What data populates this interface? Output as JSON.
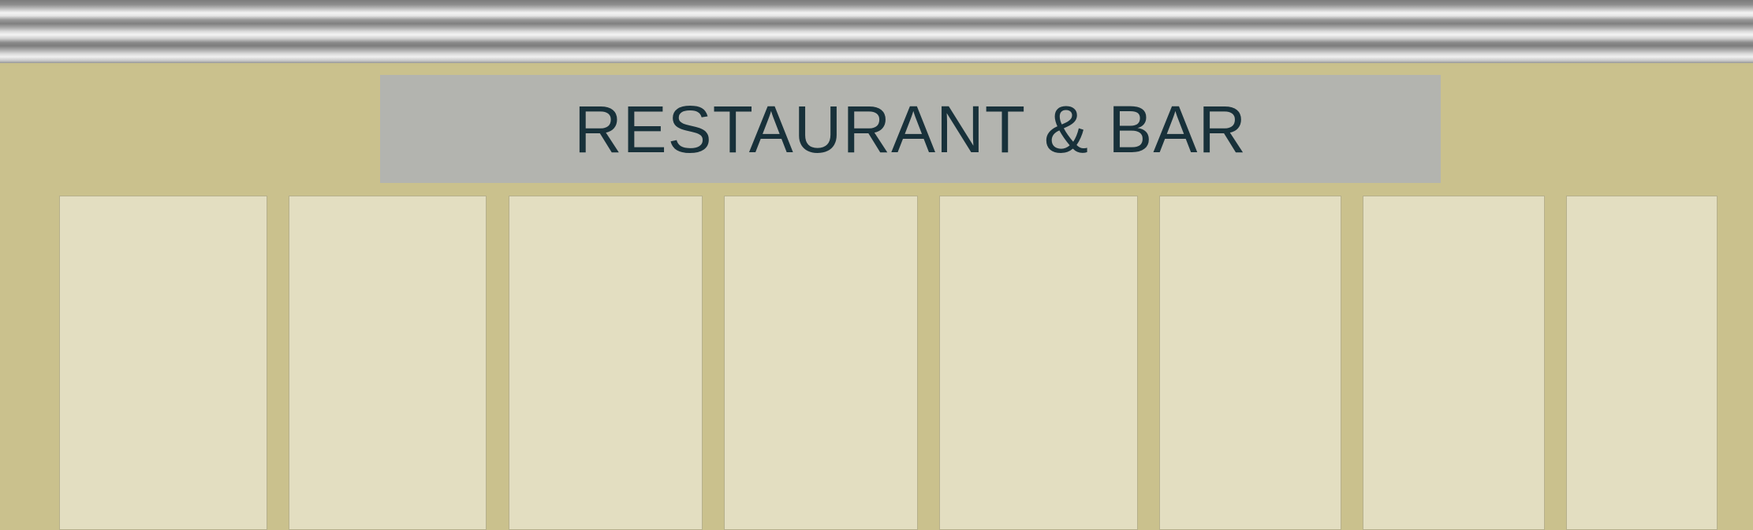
{
  "sign": {
    "text": "RESTAURANT & BAR"
  },
  "colors": {
    "facade": "#cac18d",
    "signboard": "#b3b4af",
    "sign_text": "#18313a",
    "window": "#e3dec1",
    "awning_dark": "#7b7b7b",
    "awning_light": "#f2f2f2"
  }
}
